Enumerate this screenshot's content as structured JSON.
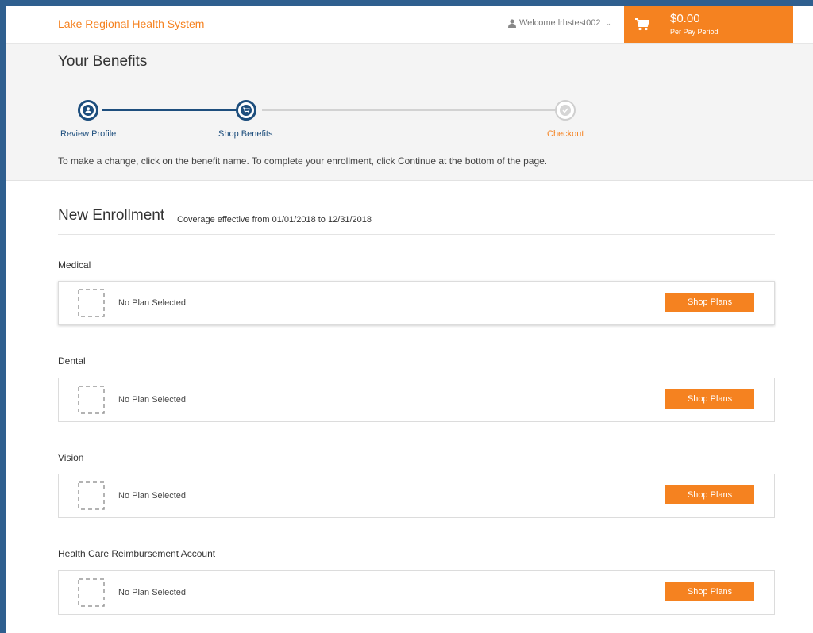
{
  "header": {
    "brand": "Lake Regional Health System",
    "welcome_text": "Welcome lrhstest002",
    "user_icon": "user-icon",
    "cart": {
      "icon": "cart-icon",
      "amount": "$0.00",
      "period": "Per Pay Period"
    }
  },
  "benefits": {
    "title": "Your Benefits",
    "steps": [
      {
        "label": "Review Profile",
        "icon": "user-icon",
        "state": "complete"
      },
      {
        "label": "Shop Benefits",
        "icon": "cart-icon",
        "state": "current"
      },
      {
        "label": "Checkout",
        "icon": "check-icon",
        "state": "pending"
      }
    ],
    "instructions": "To make a change, click on the benefit name. To complete your enrollment, click Continue at the bottom of the page."
  },
  "enrollment": {
    "title": "New Enrollment",
    "coverage": "Coverage effective from 01/01/2018 to 12/31/2018",
    "benefits": [
      {
        "name": "Medical",
        "status": "No Plan Selected",
        "button": "Shop Plans"
      },
      {
        "name": "Dental",
        "status": "No Plan Selected",
        "button": "Shop Plans"
      },
      {
        "name": "Vision",
        "status": "No Plan Selected",
        "button": "Shop Plans"
      },
      {
        "name": "Health Care Reimbursement Account",
        "status": "No Plan Selected",
        "button": "Shop Plans"
      }
    ]
  },
  "colors": {
    "accent": "#f58220",
    "primary": "#1d4e7d",
    "outer_background": "#2f5f8f"
  }
}
